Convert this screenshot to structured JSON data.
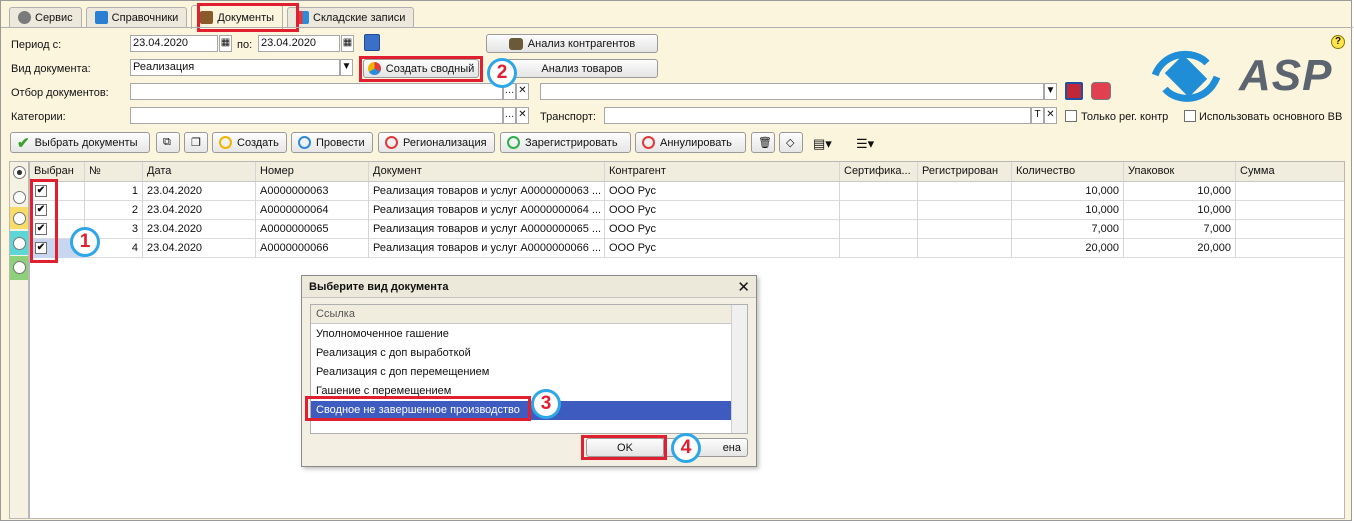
{
  "tabs": [
    {
      "label": "Сервис"
    },
    {
      "label": "Справочники"
    },
    {
      "label": "Документы"
    },
    {
      "label": "Складские записи"
    }
  ],
  "filters": {
    "period_label": "Период с:",
    "period_from": "23.04.2020",
    "period_to_label": "по:",
    "period_to": "23.04.2020",
    "doc_type_label": "Вид документа:",
    "doc_type_value": "Реализация",
    "doc_filter_label": "Отбор документов:",
    "categories_label": "Категории:",
    "transport_label": "Транспорт:",
    "only_reg_label": "Только рег. контр",
    "use_main_label": "Использовать основного ВВ"
  },
  "buttons": {
    "analysis_contractors": "Анализ контрагентов",
    "analysis_goods": "Анализ товаров",
    "create_summary": "Создать сводный"
  },
  "toolbar": {
    "select_docs": "Выбрать документы",
    "create": "Создать",
    "post": "Провести",
    "regionalize": "Регионализация",
    "register": "Зарегистрировать",
    "cancel": "Аннулировать"
  },
  "table": {
    "headers": [
      "Выбран",
      "№",
      "Дата",
      "Номер",
      "Документ",
      "Контрагент",
      "Сертифика...",
      "Регистрирован",
      "Количество",
      "Упаковок",
      "Сумма"
    ],
    "rows": [
      {
        "n": "1",
        "date": "23.04.2020",
        "num": "A0000000063",
        "doc": "Реализация товаров и услуг A0000000063 ...",
        "contr": "ООО Рус",
        "qty": "10,000",
        "pack": "10,000"
      },
      {
        "n": "2",
        "date": "23.04.2020",
        "num": "A0000000064",
        "doc": "Реализация товаров и услуг A0000000064 ...",
        "contr": "ООО Рус",
        "qty": "10,000",
        "pack": "10,000"
      },
      {
        "n": "3",
        "date": "23.04.2020",
        "num": "A0000000065",
        "doc": "Реализация товаров и услуг A0000000065 ...",
        "contr": "ООО Рус",
        "qty": "7,000",
        "pack": "7,000"
      },
      {
        "n": "4",
        "date": "23.04.2020",
        "num": "A0000000066",
        "doc": "Реализация товаров и услуг A0000000066 ...",
        "contr": "ООО Рус",
        "qty": "20,000",
        "pack": "20,000"
      }
    ]
  },
  "dialog": {
    "title": "Выберите вид документа",
    "column": "Ссылка",
    "items": [
      "Уполномоченное гашение",
      "Реализация с доп выработкой",
      "Реализация с доп перемещением",
      "Гашение с перемещением",
      "Сводное не  завершенное производство"
    ],
    "ok": "OK",
    "cancel_partial": "ена"
  },
  "markers": [
    "1",
    "2",
    "3",
    "4"
  ],
  "logo_text": "ASP",
  "colors": {
    "accent": "#e02030",
    "marker_border": "#2ea7e8",
    "selection": "#3e5bbf",
    "logo_blue": "#1f8ed6"
  }
}
